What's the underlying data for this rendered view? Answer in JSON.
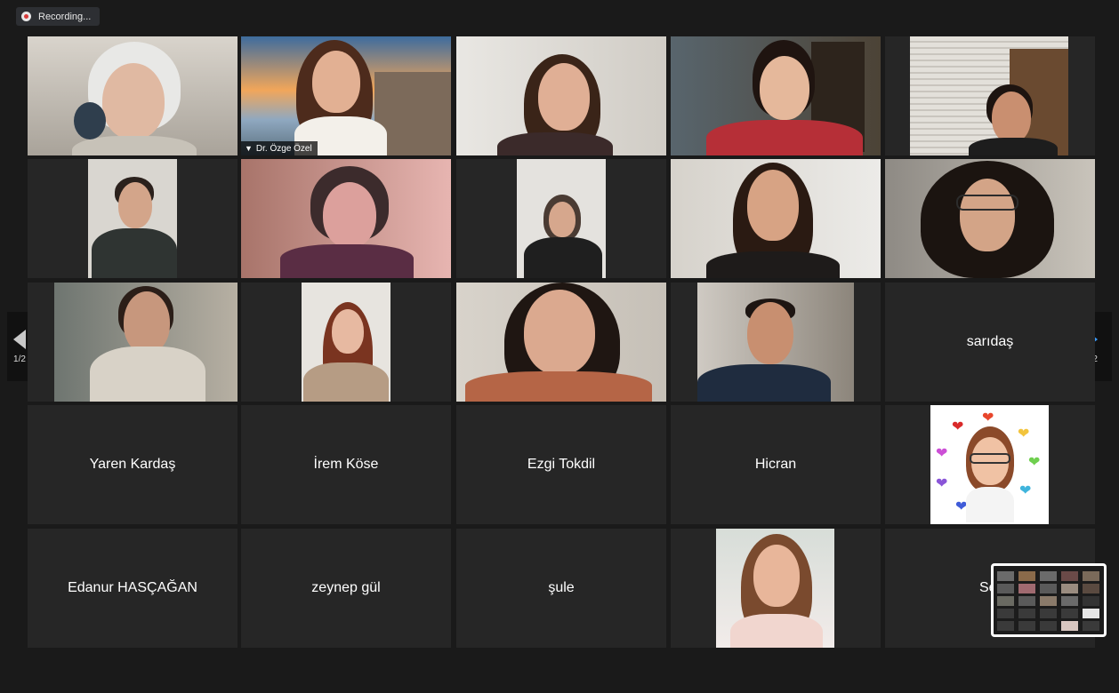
{
  "recording": {
    "label": "Recording..."
  },
  "pager": {
    "left": "1/2",
    "right": "1/2"
  },
  "active_speaker": {
    "name": "Dr. Özge Özel",
    "pin_icon": "pin-icon"
  },
  "name_tiles": {
    "r3c5": "sarıdaş",
    "r4c1": "Yaren Kardaş",
    "r4c2": "İrem Köse",
    "r4c3": "Ezgi Tokdil",
    "r4c4": "Hicran",
    "r5c1": "Edanur HASÇAĞAN",
    "r5c2": "zeynep gül",
    "r5c3": "şule",
    "r5c5": "Sede"
  },
  "colors": {
    "active_border": "#cfe28b",
    "next_arrow": "#3a9bff",
    "record_dot": "#d63a3a"
  }
}
